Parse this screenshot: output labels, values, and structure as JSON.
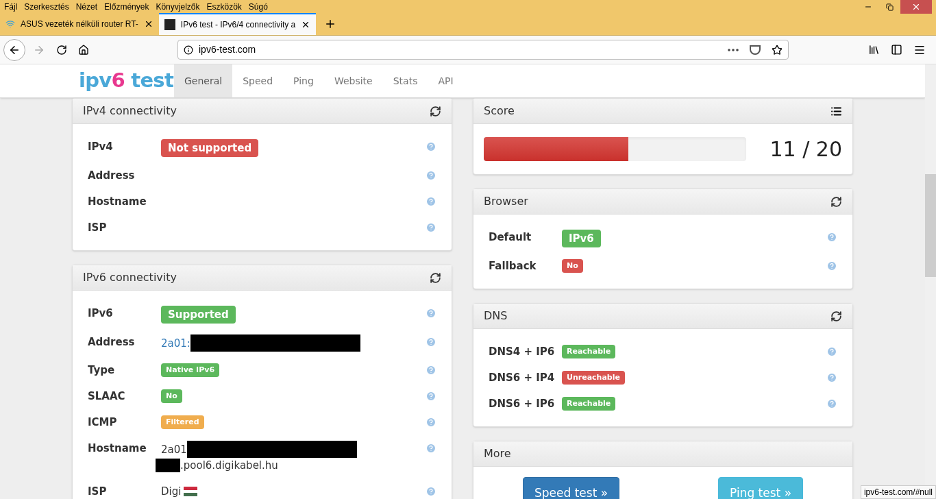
{
  "menu": [
    "Fájl",
    "Szerkesztés",
    "Nézet",
    "Előzmények",
    "Könyvjelzők",
    "Eszközök",
    "Súgó"
  ],
  "tabs": [
    {
      "title": "ASUS vezeték nélküli router RT-",
      "selected": false
    },
    {
      "title": "IPv6 test - IPv6/4 connectivity a",
      "selected": true
    }
  ],
  "url": "ipv6-test.com",
  "site": {
    "logo": {
      "part1": "ipv",
      "part2": "6",
      "part3": " test"
    },
    "nav": [
      {
        "label": "General",
        "selected": true
      },
      {
        "label": "Speed",
        "selected": false
      },
      {
        "label": "Ping",
        "selected": false
      },
      {
        "label": "Website",
        "selected": false
      },
      {
        "label": "Stats",
        "selected": false
      },
      {
        "label": "API",
        "selected": false
      }
    ]
  },
  "left_panels": [
    {
      "title": "IPv4 connectivity",
      "rows": [
        {
          "label": "IPv4",
          "value": [
            {
              "kind": "badge_large",
              "text": "Not supported",
              "color": "#d9534f"
            }
          ]
        },
        {
          "label": "Address",
          "value": []
        },
        {
          "label": "Hostname",
          "value": []
        },
        {
          "label": "ISP",
          "value": []
        }
      ]
    },
    {
      "title": "IPv6 connectivity",
      "rows": [
        {
          "label": "IPv6",
          "value": [
            {
              "kind": "badge_large",
              "text": "Supported",
              "color": "#5cb85c"
            }
          ]
        },
        {
          "label": "Address",
          "value": [
            {
              "kind": "link",
              "text": "2a01:"
            },
            {
              "kind": "redaction_long"
            }
          ]
        },
        {
          "label": "Type",
          "value": [
            {
              "kind": "badge_small",
              "text": "Native IPv6",
              "color": "#5cb85c"
            }
          ]
        },
        {
          "label": "SLAAC",
          "value": [
            {
              "kind": "badge_small",
              "text": "No",
              "color": "#5cb85c"
            }
          ]
        },
        {
          "label": "ICMP",
          "value": [
            {
              "kind": "badge_small",
              "text": "Filtered",
              "color": "#f0ad4e"
            }
          ]
        },
        {
          "label": "Hostname",
          "value": [
            {
              "kind": "text",
              "text": "2a01"
            },
            {
              "kind": "redaction_long"
            },
            {
              "kind": "break"
            },
            {
              "kind": "redaction_short"
            },
            {
              "kind": "text",
              "text": ".pool6.digikabel.hu"
            }
          ]
        },
        {
          "label": "ISP",
          "value": [
            {
              "kind": "text",
              "text": "Digi"
            },
            {
              "kind": "flag"
            }
          ]
        }
      ]
    }
  ],
  "score": {
    "title": "Score",
    "level": 0.55,
    "reading": "11 / 20"
  },
  "right_panels": [
    {
      "title": "Browser",
      "rows": [
        {
          "label": "Default",
          "value": [
            {
              "kind": "badge_large",
              "text": "IPv6",
              "color": "#5cb85c"
            }
          ]
        },
        {
          "label": "Fallback",
          "value": [
            {
              "kind": "badge_small",
              "text": "No",
              "color": "#d9534f"
            }
          ]
        }
      ]
    },
    {
      "title": "DNS",
      "rows": [
        {
          "label": "DNS4 + IP6",
          "value": [
            {
              "kind": "badge_small",
              "text": "Reachable",
              "color": "#5cb85c"
            }
          ]
        },
        {
          "label": "DNS6 + IP4",
          "value": [
            {
              "kind": "badge_small",
              "text": "Unreachable",
              "color": "#d9534f"
            }
          ]
        },
        {
          "label": "DNS6 + IP6",
          "value": [
            {
              "kind": "badge_small",
              "text": "Reachable",
              "color": "#5cb85c"
            }
          ]
        }
      ]
    }
  ],
  "more": {
    "title": "More",
    "buttons": [
      {
        "label": "Speed test »",
        "kind": "primary"
      },
      {
        "label": "Ping test »",
        "kind": "info"
      }
    ]
  },
  "status_url": "ipv6-test.com/#null"
}
